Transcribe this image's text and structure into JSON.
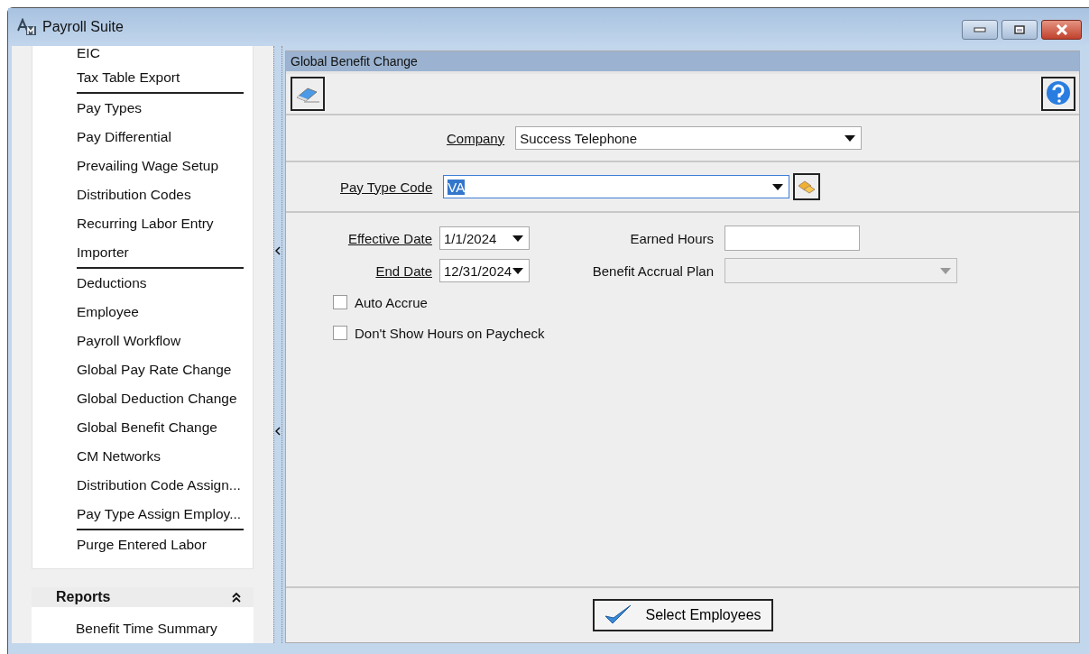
{
  "window": {
    "title": "Payroll Suite"
  },
  "sidebar": {
    "groups": [
      [
        "EIC",
        "Tax Table Export"
      ],
      [
        "Pay Types",
        "Pay Differential",
        "Prevailing Wage Setup",
        "Distribution Codes",
        "Recurring Labor Entry",
        "Importer"
      ],
      [
        "Deductions",
        "Employee",
        "Payroll Workflow",
        "Global Pay Rate Change",
        "Global Deduction Change",
        "Global Benefit Change",
        "CM Networks",
        "Distribution Code Assign...",
        "Pay Type Assign Employ..."
      ],
      [
        "Purge Entered Labor"
      ]
    ],
    "sections": [
      {
        "title": "Reports",
        "expanded": true,
        "items": [
          "Benefit Time Summary"
        ]
      }
    ]
  },
  "panel": {
    "title": "Global Benefit Change",
    "company": {
      "label": "Company",
      "value": "Success Telephone"
    },
    "pay_type_code": {
      "label": "Pay Type Code",
      "value": "VA"
    },
    "effective_date": {
      "label": "Effective Date",
      "value": "1/1/2024"
    },
    "end_date": {
      "label": "End Date",
      "value": "12/31/2024"
    },
    "earned_hours": {
      "label": "Earned Hours"
    },
    "benefit_accrual_plan": {
      "label": "Benefit Accrual Plan",
      "disabled": true
    },
    "checkboxes": [
      {
        "label": "Auto Accrue",
        "checked": false
      },
      {
        "label": "Don't Show Hours on Paycheck",
        "checked": false
      }
    ],
    "button": "Select Employees"
  }
}
